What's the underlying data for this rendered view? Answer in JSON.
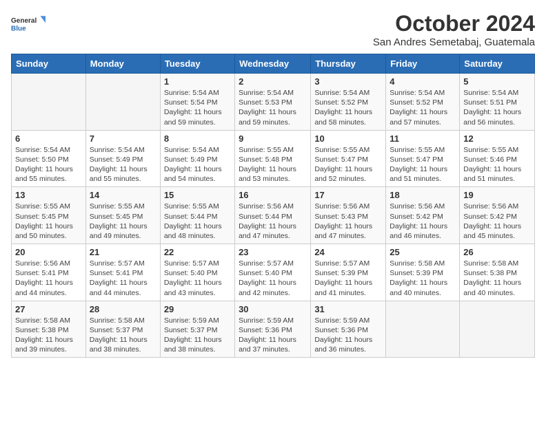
{
  "logo": {
    "general": "General",
    "blue": "Blue"
  },
  "title": "October 2024",
  "subtitle": "San Andres Semetabaj, Guatemala",
  "days": [
    "Sunday",
    "Monday",
    "Tuesday",
    "Wednesday",
    "Thursday",
    "Friday",
    "Saturday"
  ],
  "weeks": [
    [
      {
        "day": "",
        "sunrise": "",
        "sunset": "",
        "daylight": ""
      },
      {
        "day": "",
        "sunrise": "",
        "sunset": "",
        "daylight": ""
      },
      {
        "day": "1",
        "sunrise": "Sunrise: 5:54 AM",
        "sunset": "Sunset: 5:54 PM",
        "daylight": "Daylight: 11 hours and 59 minutes."
      },
      {
        "day": "2",
        "sunrise": "Sunrise: 5:54 AM",
        "sunset": "Sunset: 5:53 PM",
        "daylight": "Daylight: 11 hours and 59 minutes."
      },
      {
        "day": "3",
        "sunrise": "Sunrise: 5:54 AM",
        "sunset": "Sunset: 5:52 PM",
        "daylight": "Daylight: 11 hours and 58 minutes."
      },
      {
        "day": "4",
        "sunrise": "Sunrise: 5:54 AM",
        "sunset": "Sunset: 5:52 PM",
        "daylight": "Daylight: 11 hours and 57 minutes."
      },
      {
        "day": "5",
        "sunrise": "Sunrise: 5:54 AM",
        "sunset": "Sunset: 5:51 PM",
        "daylight": "Daylight: 11 hours and 56 minutes."
      }
    ],
    [
      {
        "day": "6",
        "sunrise": "Sunrise: 5:54 AM",
        "sunset": "Sunset: 5:50 PM",
        "daylight": "Daylight: 11 hours and 55 minutes."
      },
      {
        "day": "7",
        "sunrise": "Sunrise: 5:54 AM",
        "sunset": "Sunset: 5:49 PM",
        "daylight": "Daylight: 11 hours and 55 minutes."
      },
      {
        "day": "8",
        "sunrise": "Sunrise: 5:54 AM",
        "sunset": "Sunset: 5:49 PM",
        "daylight": "Daylight: 11 hours and 54 minutes."
      },
      {
        "day": "9",
        "sunrise": "Sunrise: 5:55 AM",
        "sunset": "Sunset: 5:48 PM",
        "daylight": "Daylight: 11 hours and 53 minutes."
      },
      {
        "day": "10",
        "sunrise": "Sunrise: 5:55 AM",
        "sunset": "Sunset: 5:47 PM",
        "daylight": "Daylight: 11 hours and 52 minutes."
      },
      {
        "day": "11",
        "sunrise": "Sunrise: 5:55 AM",
        "sunset": "Sunset: 5:47 PM",
        "daylight": "Daylight: 11 hours and 51 minutes."
      },
      {
        "day": "12",
        "sunrise": "Sunrise: 5:55 AM",
        "sunset": "Sunset: 5:46 PM",
        "daylight": "Daylight: 11 hours and 51 minutes."
      }
    ],
    [
      {
        "day": "13",
        "sunrise": "Sunrise: 5:55 AM",
        "sunset": "Sunset: 5:45 PM",
        "daylight": "Daylight: 11 hours and 50 minutes."
      },
      {
        "day": "14",
        "sunrise": "Sunrise: 5:55 AM",
        "sunset": "Sunset: 5:45 PM",
        "daylight": "Daylight: 11 hours and 49 minutes."
      },
      {
        "day": "15",
        "sunrise": "Sunrise: 5:55 AM",
        "sunset": "Sunset: 5:44 PM",
        "daylight": "Daylight: 11 hours and 48 minutes."
      },
      {
        "day": "16",
        "sunrise": "Sunrise: 5:56 AM",
        "sunset": "Sunset: 5:44 PM",
        "daylight": "Daylight: 11 hours and 47 minutes."
      },
      {
        "day": "17",
        "sunrise": "Sunrise: 5:56 AM",
        "sunset": "Sunset: 5:43 PM",
        "daylight": "Daylight: 11 hours and 47 minutes."
      },
      {
        "day": "18",
        "sunrise": "Sunrise: 5:56 AM",
        "sunset": "Sunset: 5:42 PM",
        "daylight": "Daylight: 11 hours and 46 minutes."
      },
      {
        "day": "19",
        "sunrise": "Sunrise: 5:56 AM",
        "sunset": "Sunset: 5:42 PM",
        "daylight": "Daylight: 11 hours and 45 minutes."
      }
    ],
    [
      {
        "day": "20",
        "sunrise": "Sunrise: 5:56 AM",
        "sunset": "Sunset: 5:41 PM",
        "daylight": "Daylight: 11 hours and 44 minutes."
      },
      {
        "day": "21",
        "sunrise": "Sunrise: 5:57 AM",
        "sunset": "Sunset: 5:41 PM",
        "daylight": "Daylight: 11 hours and 44 minutes."
      },
      {
        "day": "22",
        "sunrise": "Sunrise: 5:57 AM",
        "sunset": "Sunset: 5:40 PM",
        "daylight": "Daylight: 11 hours and 43 minutes."
      },
      {
        "day": "23",
        "sunrise": "Sunrise: 5:57 AM",
        "sunset": "Sunset: 5:40 PM",
        "daylight": "Daylight: 11 hours and 42 minutes."
      },
      {
        "day": "24",
        "sunrise": "Sunrise: 5:57 AM",
        "sunset": "Sunset: 5:39 PM",
        "daylight": "Daylight: 11 hours and 41 minutes."
      },
      {
        "day": "25",
        "sunrise": "Sunrise: 5:58 AM",
        "sunset": "Sunset: 5:39 PM",
        "daylight": "Daylight: 11 hours and 40 minutes."
      },
      {
        "day": "26",
        "sunrise": "Sunrise: 5:58 AM",
        "sunset": "Sunset: 5:38 PM",
        "daylight": "Daylight: 11 hours and 40 minutes."
      }
    ],
    [
      {
        "day": "27",
        "sunrise": "Sunrise: 5:58 AM",
        "sunset": "Sunset: 5:38 PM",
        "daylight": "Daylight: 11 hours and 39 minutes."
      },
      {
        "day": "28",
        "sunrise": "Sunrise: 5:58 AM",
        "sunset": "Sunset: 5:37 PM",
        "daylight": "Daylight: 11 hours and 38 minutes."
      },
      {
        "day": "29",
        "sunrise": "Sunrise: 5:59 AM",
        "sunset": "Sunset: 5:37 PM",
        "daylight": "Daylight: 11 hours and 38 minutes."
      },
      {
        "day": "30",
        "sunrise": "Sunrise: 5:59 AM",
        "sunset": "Sunset: 5:36 PM",
        "daylight": "Daylight: 11 hours and 37 minutes."
      },
      {
        "day": "31",
        "sunrise": "Sunrise: 5:59 AM",
        "sunset": "Sunset: 5:36 PM",
        "daylight": "Daylight: 11 hours and 36 minutes."
      },
      {
        "day": "",
        "sunrise": "",
        "sunset": "",
        "daylight": ""
      },
      {
        "day": "",
        "sunrise": "",
        "sunset": "",
        "daylight": ""
      }
    ]
  ]
}
